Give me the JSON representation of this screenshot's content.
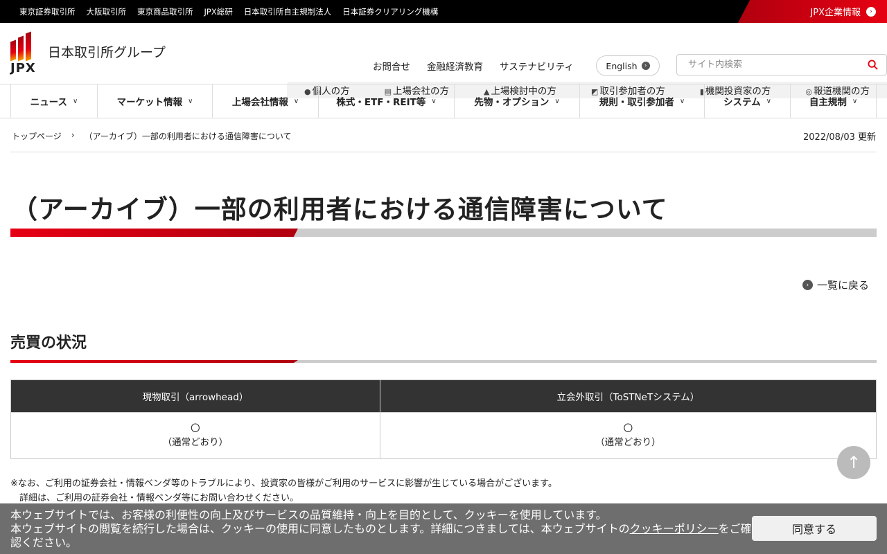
{
  "topbar": {
    "links": [
      "東京証券取引所",
      "大阪取引所",
      "東京商品取引所",
      "JPX総研",
      "日本取引所自主規制法人",
      "日本証券クリアリング機構"
    ],
    "corporate": "JPX企業情報"
  },
  "header": {
    "logo_text": "日本取引所グループ",
    "logo_abbr": "JPX",
    "links": [
      "お問合せ",
      "金融経済教育",
      "サステナビリティ"
    ],
    "english": "English",
    "search_placeholder": "サイト内検索",
    "audience": [
      "個人の方",
      "上場会社の方",
      "上場検討中の方",
      "取引参加者の方",
      "機関投資家の方",
      "報道機関の方"
    ]
  },
  "nav": [
    "ニュース",
    "マーケット情報",
    "上場会社情報",
    "株式・ETF・REIT等",
    "先物・オプション",
    "規則・取引参加者",
    "システム",
    "自主規制"
  ],
  "breadcrumb": [
    "トップページ",
    "（アーカイブ）一部の利用者における通信障害について"
  ],
  "updated": "2022/08/03 更新",
  "title": "（アーカイブ）一部の利用者における通信障害について",
  "back": "一覧に戻る",
  "section": "売買の状況",
  "table": {
    "headers": [
      "現物取引（arrowhead）",
      "立会外取引（ToSTNeTシステム）"
    ],
    "cells": [
      {
        "mark": "〇",
        "status": "（通常どおり）"
      },
      {
        "mark": "〇",
        "status": "（通常どおり）"
      }
    ]
  },
  "notes": [
    "※なお、ご利用の証券会社・情報ベンダ等のトラブルにより、投資家の皆様がご利用のサービスに影響が生じている場合がございます。",
    "　詳細は、ご利用の証券会社・情報ベンダ等にお問い合わせください。"
  ],
  "cookie": {
    "line1": "本ウェブサイトでは、お客様の利便性の向上及びサービスの品質維持・向上を目的として、クッキーを使用しています。",
    "line2": "本ウェブサイトの閲覧を続行した場合は、クッキーの使用に同意したものとします。詳細につきましては、本ウェブサイトの",
    "link": "クッキーポリシー",
    "line3": "をご確認ください。",
    "agree": "同意する"
  }
}
